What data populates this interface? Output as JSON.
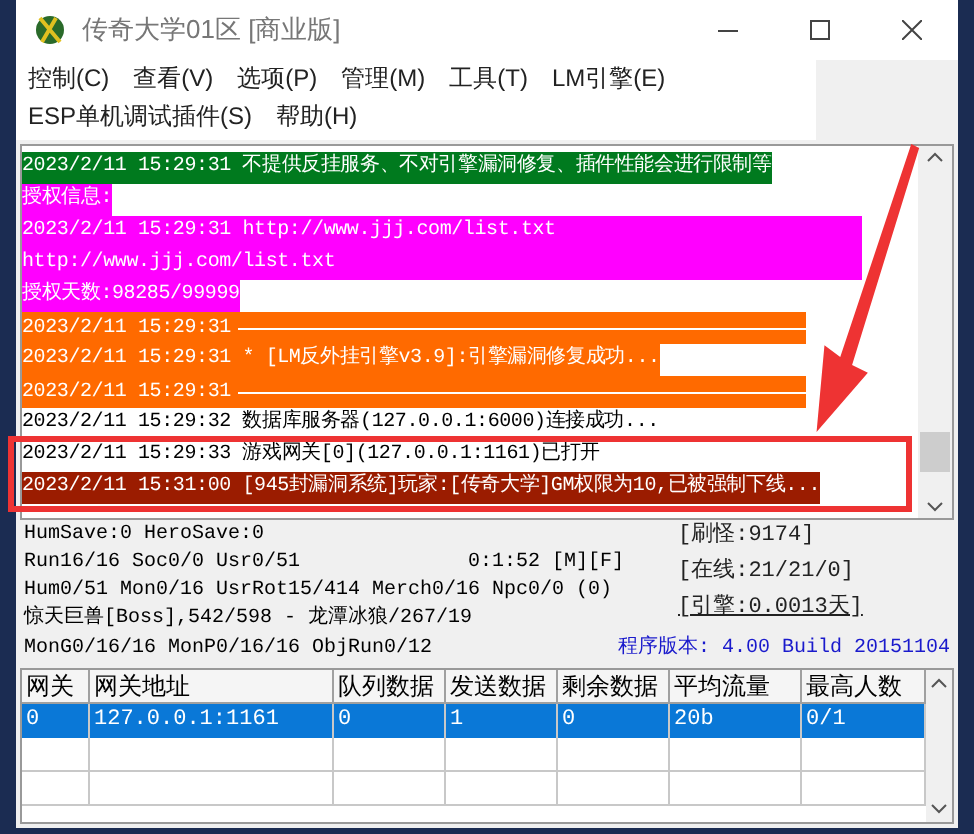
{
  "window": {
    "title": "传奇大学01区 [商业版]"
  },
  "menu": [
    {
      "label": "控制(C)"
    },
    {
      "label": "查看(V)"
    },
    {
      "label": "选项(P)"
    },
    {
      "label": "管理(M)"
    },
    {
      "label": "工具(T)"
    },
    {
      "label": "LM引擎(E)"
    },
    {
      "label": "ESP单机调试插件(S)"
    },
    {
      "label": "帮助(H)"
    }
  ],
  "log": [
    {
      "kind": "text",
      "color": "#007a1e",
      "text": "2023/2/11 15:29:31 不提供反挂服务、不对引擎漏洞修复、插件性能会进行限制等"
    },
    {
      "kind": "text",
      "color": "#ff00ff",
      "text": "授权信息:"
    },
    {
      "kind": "text",
      "color": "#ff00ff",
      "text": "2023/2/11 15:29:31 http://www.jjj.com/list.txt http://www.jjj.com/list.txt"
    },
    {
      "kind": "text",
      "color": "#ff00ff",
      "text": "授权天数:98285/99999"
    },
    {
      "kind": "separator",
      "color": "#ff6a00",
      "text": "2023/2/11 15:29:31"
    },
    {
      "kind": "text",
      "color": "#ff6a00",
      "text": "2023/2/11 15:29:31 * [LM反外挂引擎v3.9]:引擎漏洞修复成功..."
    },
    {
      "kind": "separator",
      "color": "#ff6a00",
      "text": "2023/2/11 15:29:31"
    },
    {
      "kind": "text",
      "color": "#ffffff",
      "text": "2023/2/11 15:29:32 数据库服务器(127.0.0.1:6000)连接成功..."
    },
    {
      "kind": "text",
      "color": "#ffffff",
      "text": "2023/2/11 15:29:33 游戏网关[0](127.0.0.1:1161)已打开"
    },
    {
      "kind": "text",
      "color": "#9b1c00",
      "text": "2023/2/11 15:31:00 [945封漏洞系统]玩家:[传奇大学]GM权限为10,已被强制下线..."
    }
  ],
  "status": {
    "left": [
      {
        "text": "HumSave:0 HeroSave:0"
      },
      {
        "text": "Run16/16 Soc0/0 Usr0/51",
        "extra": "0:1:52 [M][F]"
      },
      {
        "text": "Hum0/51 Mon0/16 UsrRot15/414 Merch0/16 Npc0/0 (0)"
      },
      {
        "text": "惊天巨兽[Boss],542/598 - 龙潭冰狼/267/19"
      },
      {
        "text": "MonG0/16/16 MonP0/16/16 ObjRun0/12"
      }
    ],
    "right": [
      {
        "kind": "plain",
        "text": "[刷怪:9174]"
      },
      {
        "kind": "plain",
        "text": "[在线:21/21/0]"
      },
      {
        "kind": "link",
        "text": "[引擎:0.0013天]"
      },
      {
        "kind": "version",
        "text": "程序版本: 4.00 Build 20151104"
      }
    ]
  },
  "table": {
    "columns": [
      "网关",
      "网关地址",
      "队列数据",
      "发送数据",
      "剩余数据",
      "平均流量",
      "最高人数"
    ],
    "rows": [
      {
        "selected": true,
        "cells": [
          "0",
          "127.0.0.1:1161",
          "0",
          "1",
          "0",
          "20b",
          "0/1"
        ]
      }
    ]
  }
}
